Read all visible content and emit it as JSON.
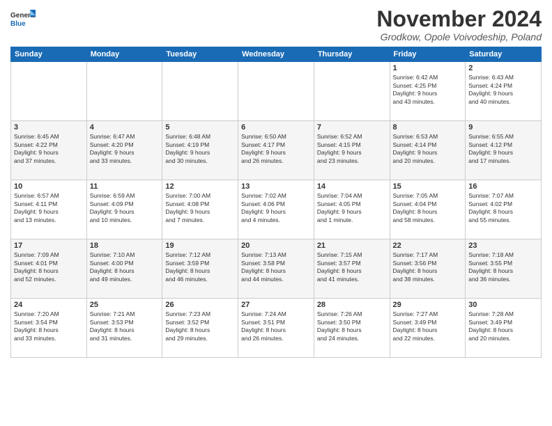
{
  "logo": {
    "general": "General",
    "blue": "Blue"
  },
  "title": "November 2024",
  "location": "Grodkow, Opole Voivodeship, Poland",
  "headers": [
    "Sunday",
    "Monday",
    "Tuesday",
    "Wednesday",
    "Thursday",
    "Friday",
    "Saturday"
  ],
  "weeks": [
    [
      {
        "day": "",
        "info": ""
      },
      {
        "day": "",
        "info": ""
      },
      {
        "day": "",
        "info": ""
      },
      {
        "day": "",
        "info": ""
      },
      {
        "day": "",
        "info": ""
      },
      {
        "day": "1",
        "info": "Sunrise: 6:42 AM\nSunset: 4:25 PM\nDaylight: 9 hours\nand 43 minutes."
      },
      {
        "day": "2",
        "info": "Sunrise: 6:43 AM\nSunset: 4:24 PM\nDaylight: 9 hours\nand 40 minutes."
      }
    ],
    [
      {
        "day": "3",
        "info": "Sunrise: 6:45 AM\nSunset: 4:22 PM\nDaylight: 9 hours\nand 37 minutes."
      },
      {
        "day": "4",
        "info": "Sunrise: 6:47 AM\nSunset: 4:20 PM\nDaylight: 9 hours\nand 33 minutes."
      },
      {
        "day": "5",
        "info": "Sunrise: 6:48 AM\nSunset: 4:19 PM\nDaylight: 9 hours\nand 30 minutes."
      },
      {
        "day": "6",
        "info": "Sunrise: 6:50 AM\nSunset: 4:17 PM\nDaylight: 9 hours\nand 26 minutes."
      },
      {
        "day": "7",
        "info": "Sunrise: 6:52 AM\nSunset: 4:15 PM\nDaylight: 9 hours\nand 23 minutes."
      },
      {
        "day": "8",
        "info": "Sunrise: 6:53 AM\nSunset: 4:14 PM\nDaylight: 9 hours\nand 20 minutes."
      },
      {
        "day": "9",
        "info": "Sunrise: 6:55 AM\nSunset: 4:12 PM\nDaylight: 9 hours\nand 17 minutes."
      }
    ],
    [
      {
        "day": "10",
        "info": "Sunrise: 6:57 AM\nSunset: 4:11 PM\nDaylight: 9 hours\nand 13 minutes."
      },
      {
        "day": "11",
        "info": "Sunrise: 6:59 AM\nSunset: 4:09 PM\nDaylight: 9 hours\nand 10 minutes."
      },
      {
        "day": "12",
        "info": "Sunrise: 7:00 AM\nSunset: 4:08 PM\nDaylight: 9 hours\nand 7 minutes."
      },
      {
        "day": "13",
        "info": "Sunrise: 7:02 AM\nSunset: 4:06 PM\nDaylight: 9 hours\nand 4 minutes."
      },
      {
        "day": "14",
        "info": "Sunrise: 7:04 AM\nSunset: 4:05 PM\nDaylight: 9 hours\nand 1 minute."
      },
      {
        "day": "15",
        "info": "Sunrise: 7:05 AM\nSunset: 4:04 PM\nDaylight: 8 hours\nand 58 minutes."
      },
      {
        "day": "16",
        "info": "Sunrise: 7:07 AM\nSunset: 4:02 PM\nDaylight: 8 hours\nand 55 minutes."
      }
    ],
    [
      {
        "day": "17",
        "info": "Sunrise: 7:09 AM\nSunset: 4:01 PM\nDaylight: 8 hours\nand 52 minutes."
      },
      {
        "day": "18",
        "info": "Sunrise: 7:10 AM\nSunset: 4:00 PM\nDaylight: 8 hours\nand 49 minutes."
      },
      {
        "day": "19",
        "info": "Sunrise: 7:12 AM\nSunset: 3:59 PM\nDaylight: 8 hours\nand 46 minutes."
      },
      {
        "day": "20",
        "info": "Sunrise: 7:13 AM\nSunset: 3:58 PM\nDaylight: 8 hours\nand 44 minutes."
      },
      {
        "day": "21",
        "info": "Sunrise: 7:15 AM\nSunset: 3:57 PM\nDaylight: 8 hours\nand 41 minutes."
      },
      {
        "day": "22",
        "info": "Sunrise: 7:17 AM\nSunset: 3:56 PM\nDaylight: 8 hours\nand 38 minutes."
      },
      {
        "day": "23",
        "info": "Sunrise: 7:18 AM\nSunset: 3:55 PM\nDaylight: 8 hours\nand 36 minutes."
      }
    ],
    [
      {
        "day": "24",
        "info": "Sunrise: 7:20 AM\nSunset: 3:54 PM\nDaylight: 8 hours\nand 33 minutes."
      },
      {
        "day": "25",
        "info": "Sunrise: 7:21 AM\nSunset: 3:53 PM\nDaylight: 8 hours\nand 31 minutes."
      },
      {
        "day": "26",
        "info": "Sunrise: 7:23 AM\nSunset: 3:52 PM\nDaylight: 8 hours\nand 29 minutes."
      },
      {
        "day": "27",
        "info": "Sunrise: 7:24 AM\nSunset: 3:51 PM\nDaylight: 8 hours\nand 26 minutes."
      },
      {
        "day": "28",
        "info": "Sunrise: 7:26 AM\nSunset: 3:50 PM\nDaylight: 8 hours\nand 24 minutes."
      },
      {
        "day": "29",
        "info": "Sunrise: 7:27 AM\nSunset: 3:49 PM\nDaylight: 8 hours\nand 22 minutes."
      },
      {
        "day": "30",
        "info": "Sunrise: 7:28 AM\nSunset: 3:49 PM\nDaylight: 8 hours\nand 20 minutes."
      }
    ]
  ]
}
